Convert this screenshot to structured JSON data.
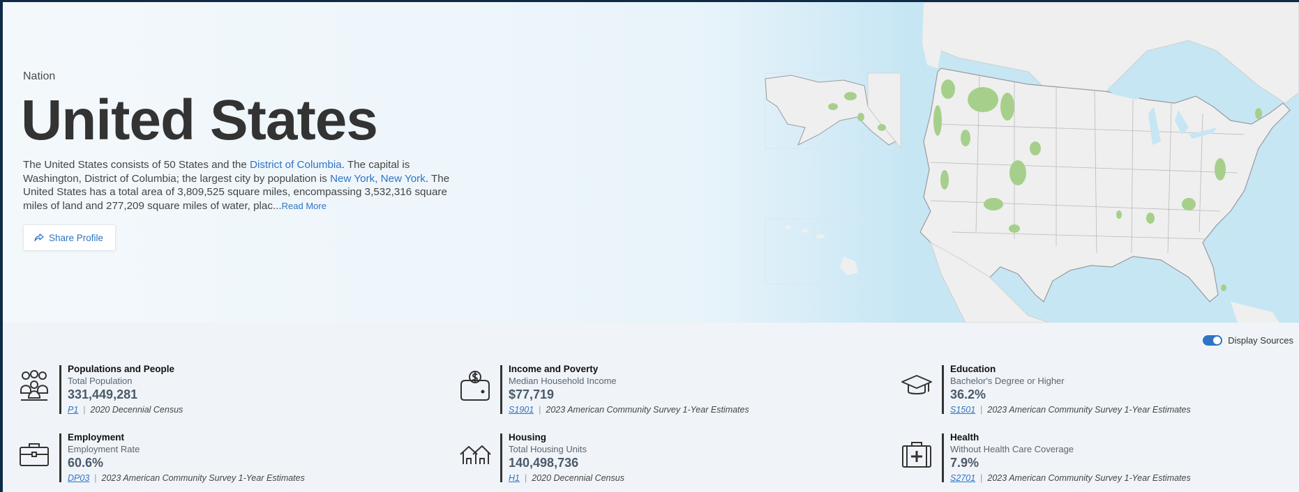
{
  "hero": {
    "eyebrow": "Nation",
    "title": "United States",
    "desc": {
      "p1": "The United States consists of 50 States and the ",
      "link1": "District of Columbia",
      "p2": ". The capital is Washington, District of Columbia; the largest city by population is ",
      "link2": "New York, New York",
      "p3": ". The United States has a total area of 3,809,525 square miles, encompassing 3,532,316 square miles of land and 277,209 square miles of water, plac...",
      "read_more": "Read More"
    },
    "share_label": "Share Profile"
  },
  "sources_toggle": {
    "label": "Display Sources",
    "on": true
  },
  "stats": [
    {
      "icon": "people-icon",
      "category": "Populations and People",
      "label": "Total Population",
      "value": "331,449,281",
      "code": "P1",
      "source": "2020 Decennial Census"
    },
    {
      "icon": "income-wallet-icon",
      "category": "Income and Poverty",
      "label": "Median Household Income",
      "value": "$77,719",
      "code": "S1901",
      "source": "2023 American Community Survey 1-Year Estimates"
    },
    {
      "icon": "graduation-cap-icon",
      "category": "Education",
      "label": "Bachelor's Degree or Higher",
      "value": "36.2%",
      "code": "S1501",
      "source": "2023 American Community Survey 1-Year Estimates"
    },
    {
      "icon": "briefcase-icon",
      "category": "Employment",
      "label": "Employment Rate",
      "value": "60.6%",
      "code": "DP03",
      "source": "2023 American Community Survey 1-Year Estimates"
    },
    {
      "icon": "houses-icon",
      "category": "Housing",
      "label": "Total Housing Units",
      "value": "140,498,736",
      "code": "H1",
      "source": "2020 Decennial Census"
    },
    {
      "icon": "medical-kit-icon",
      "category": "Health",
      "label": "Without Health Care Coverage",
      "value": "7.9%",
      "code": "S2701",
      "source": "2023 American Community Survey 1-Year Estimates"
    }
  ],
  "colors": {
    "accent": "#2f73c4",
    "map_water": "#c6e6f4",
    "map_land": "#efefef",
    "map_forest": "#a7cf8c"
  }
}
